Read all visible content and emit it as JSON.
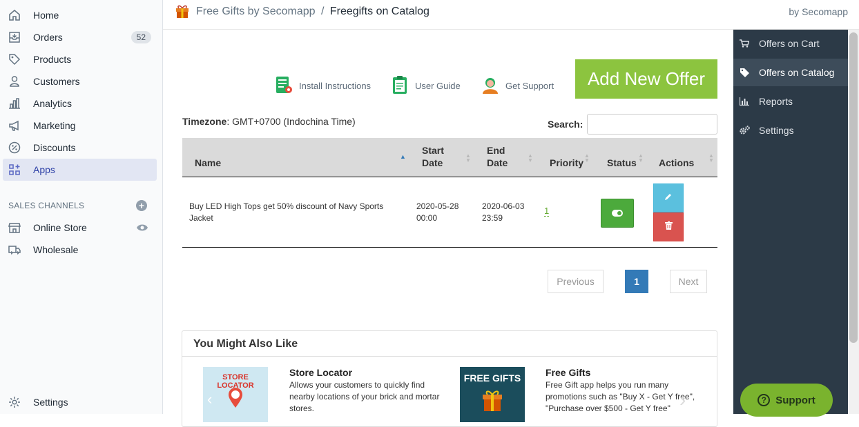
{
  "sidebar": {
    "items": [
      {
        "label": "Home",
        "icon": "home-icon"
      },
      {
        "label": "Orders",
        "icon": "orders-icon",
        "badge": "52"
      },
      {
        "label": "Products",
        "icon": "tag-icon"
      },
      {
        "label": "Customers",
        "icon": "person-icon"
      },
      {
        "label": "Analytics",
        "icon": "bar-chart-icon"
      },
      {
        "label": "Marketing",
        "icon": "megaphone-icon"
      },
      {
        "label": "Discounts",
        "icon": "discount-icon"
      },
      {
        "label": "Apps",
        "icon": "apps-icon",
        "active": true
      }
    ],
    "sales_channels_heading": "SALES CHANNELS",
    "channels": [
      {
        "label": "Online Store",
        "icon": "store-icon"
      },
      {
        "label": "Wholesale",
        "icon": "wholesale-icon"
      }
    ],
    "settings_label": "Settings"
  },
  "topbar": {
    "app_name": "Free Gifts by Secomapp",
    "separator": "/",
    "page": "Freegifts on Catalog",
    "by": "by Secomapp"
  },
  "right_menu": {
    "items": [
      {
        "label": "Offers on Cart",
        "icon": "cart-icon"
      },
      {
        "label": "Offers on Catalog",
        "icon": "tag-icon",
        "active": true
      },
      {
        "label": "Reports",
        "icon": "report-icon"
      },
      {
        "label": "Settings",
        "icon": "gears-icon"
      }
    ]
  },
  "actions": {
    "install_instructions": "Install Instructions",
    "user_guide": "User Guide",
    "get_support": "Get Support",
    "add_new_offer": "Add New Offer"
  },
  "timezone": {
    "label": "Timezone",
    "value": ": GMT+0700 (Indochina Time)"
  },
  "search": {
    "label": "Search:",
    "value": "",
    "placeholder": ""
  },
  "table": {
    "columns": [
      "Name",
      "Start Date",
      "End Date",
      "Priority",
      "Status",
      "Actions"
    ],
    "rows": [
      {
        "name": "Buy LED High Tops get 50% discount of Navy Sports Jacket",
        "start_date": "2020-05-28 00:00",
        "end_date": "2020-06-03 23:59",
        "priority": "1",
        "status_on": true
      }
    ]
  },
  "pagination": {
    "previous": "Previous",
    "current": "1",
    "next": "Next"
  },
  "also_like": {
    "heading": "You Might Also Like",
    "cards": [
      {
        "image_text": "STORE LOCATOR",
        "title": "Store Locator",
        "description": "Allows your customers to quickly find nearby locations of your brick and mortar stores."
      },
      {
        "image_text": "FREE GIFTS",
        "title": "Free Gifts",
        "description": "Free Gift app helps you run many promotions such as \"Buy X - Get Y free\", \"Purchase over $500 - Get Y free\""
      }
    ]
  },
  "support_button": "Support",
  "colors": {
    "accent": "#8cc43f",
    "sidebar_active": "#e2e6f3",
    "right_panel": "#2c3a47",
    "primary": "#337ab7"
  }
}
